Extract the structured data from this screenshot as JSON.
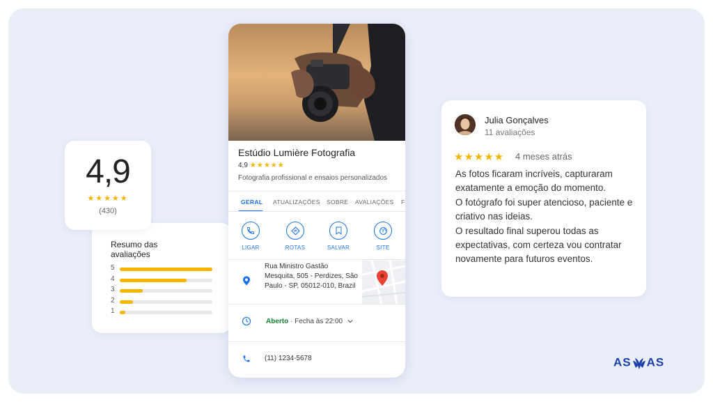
{
  "rating_card": {
    "value": "4,9",
    "stars": "★★★★★",
    "count": "(430)"
  },
  "summary": {
    "title": "Resumo das avaliações",
    "bars": [
      {
        "label": "5",
        "fraction": 1.0
      },
      {
        "label": "4",
        "fraction": 0.72
      },
      {
        "label": "3",
        "fraction": 0.25
      },
      {
        "label": "2",
        "fraction": 0.14
      },
      {
        "label": "1",
        "fraction": 0.06
      }
    ]
  },
  "business": {
    "name": "Estúdio Lumière Fotografia",
    "rating": "4,9",
    "stars": "★★★★★",
    "description": "Fotografia profissional e ensaios personalizados",
    "tabs": [
      "GERAL",
      "ATUALIZAÇÕES",
      "SOBRE",
      "AVALIAÇÕES",
      "F"
    ],
    "actions": {
      "call": "LIGAR",
      "routes": "ROTAS",
      "save": "SALVAR",
      "site": "SITE"
    },
    "address": "Rua Ministro Gastão Mesquita, 505 - Perdizes, São Paulo - SP, 05012-010, Brazil",
    "hours_status": "Aberto",
    "hours_separator": "·",
    "hours_detail": "Fecha às 22:00",
    "phone": "(11) 1234-5678"
  },
  "review": {
    "name": "Julia Gonçalves",
    "sub": "11 avaliações",
    "stars": "★★★★★",
    "time": "4 meses atrás",
    "paragraphs": [
      "As fotos ficaram incríveis, capturaram exatamente a emoção do momento.",
      "O fotógrafo foi super atencioso, paciente e criativo nas ideias.",
      "O resultado final superou todas as expectativas, com certeza vou contratar novamente para futuros eventos."
    ]
  },
  "logo": {
    "left": "AS",
    "right": "AS"
  },
  "colors": {
    "accent": "#1a73e8",
    "star": "#f4b400",
    "open": "#188038",
    "brand": "#1b3fa6",
    "background": "#e9eef9"
  }
}
